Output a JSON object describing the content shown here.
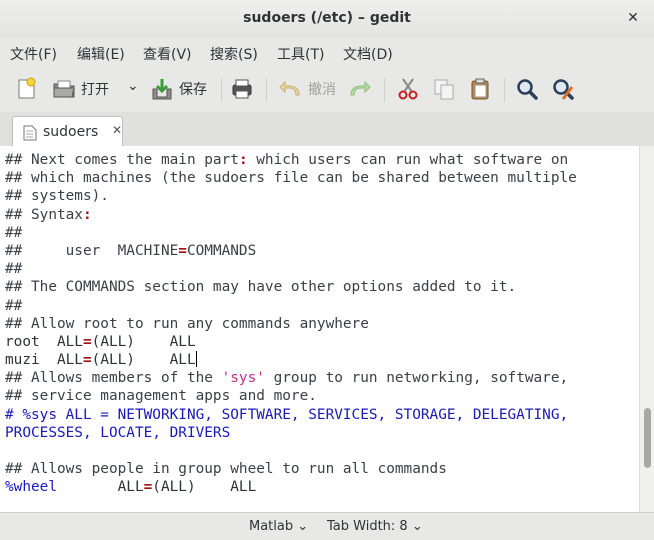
{
  "window": {
    "title": "sudoers (/etc) – gedit",
    "close_glyph": "✕"
  },
  "menubar": {
    "items": [
      {
        "label": "文件(F)"
      },
      {
        "label": "编辑(E)"
      },
      {
        "label": "查看(V)"
      },
      {
        "label": "搜索(S)"
      },
      {
        "label": "工具(T)"
      },
      {
        "label": "文档(D)"
      }
    ]
  },
  "toolbar": {
    "open_label": "打开",
    "save_label": "保存",
    "undo_label": "撤消",
    "dropdown_glyph": "⌄",
    "icons": [
      "new-document-icon",
      "open-folder-icon",
      "dropdown-arrow-icon",
      "save-icon",
      "print-icon",
      "undo-icon",
      "redo-icon",
      "cut-icon",
      "copy-icon",
      "paste-icon",
      "search-icon",
      "search-replace-icon"
    ]
  },
  "tab": {
    "label": "sudoers",
    "close_glyph": "✕"
  },
  "editor": {
    "lines": [
      [
        {
          "t": "## Next comes the main part",
          "c": "c-comment"
        },
        {
          "t": ":",
          "c": "c-red"
        },
        {
          "t": " which users can run what software on",
          "c": "c-comment"
        }
      ],
      [
        {
          "t": "## which machines (the sudoers file can be shared between multiple",
          "c": "c-comment"
        }
      ],
      [
        {
          "t": "## systems).",
          "c": "c-comment"
        }
      ],
      [
        {
          "t": "## Syntax",
          "c": "c-comment"
        },
        {
          "t": ":",
          "c": "c-red"
        }
      ],
      [
        {
          "t": "##",
          "c": "c-comment"
        }
      ],
      [
        {
          "t": "##     user  MACHINE",
          "c": "c-comment"
        },
        {
          "t": "=",
          "c": "c-red"
        },
        {
          "t": "COMMANDS",
          "c": "c-comment"
        }
      ],
      [
        {
          "t": "##",
          "c": "c-comment"
        }
      ],
      [
        {
          "t": "## The COMMANDS section may have other options added to it.",
          "c": "c-comment"
        }
      ],
      [
        {
          "t": "##",
          "c": "c-comment"
        }
      ],
      [
        {
          "t": "## Allow root to run any commands anywhere",
          "c": "c-comment"
        }
      ],
      [
        {
          "t": "root  ALL",
          "c": ""
        },
        {
          "t": "=",
          "c": "c-red"
        },
        {
          "t": "(ALL)    ALL",
          "c": ""
        }
      ],
      [
        {
          "t": "muzi  ALL",
          "c": ""
        },
        {
          "t": "=",
          "c": "c-red"
        },
        {
          "t": "(ALL)    ALL",
          "c": ""
        },
        {
          "t": "",
          "c": "cursor"
        }
      ],
      [
        {
          "t": "## Allows members of the ",
          "c": "c-comment"
        },
        {
          "t": "'sys'",
          "c": "c-str"
        },
        {
          "t": " group to run networking, software,",
          "c": "c-comment"
        }
      ],
      [
        {
          "t": "## service management apps and more.",
          "c": "c-comment"
        }
      ],
      [
        {
          "t": "# %sys ALL = NETWORKING, SOFTWARE, SERVICES, STORAGE, DELEGATING,",
          "c": "c-blue"
        }
      ],
      [
        {
          "t": "PROCESSES, LOCATE, DRIVERS",
          "c": "c-blue"
        }
      ],
      [
        {
          "t": "",
          "c": ""
        }
      ],
      [
        {
          "t": "## Allows people in group wheel to run all commands",
          "c": "c-comment"
        }
      ],
      [
        {
          "t": "%wheel",
          "c": "c-kw"
        },
        {
          "t": "       ALL",
          "c": ""
        },
        {
          "t": "=",
          "c": "c-red"
        },
        {
          "t": "(ALL)    ALL",
          "c": ""
        }
      ]
    ]
  },
  "statusbar": {
    "language": "Matlab ⌄",
    "tab_width": "Tab Width: 8 ⌄"
  }
}
